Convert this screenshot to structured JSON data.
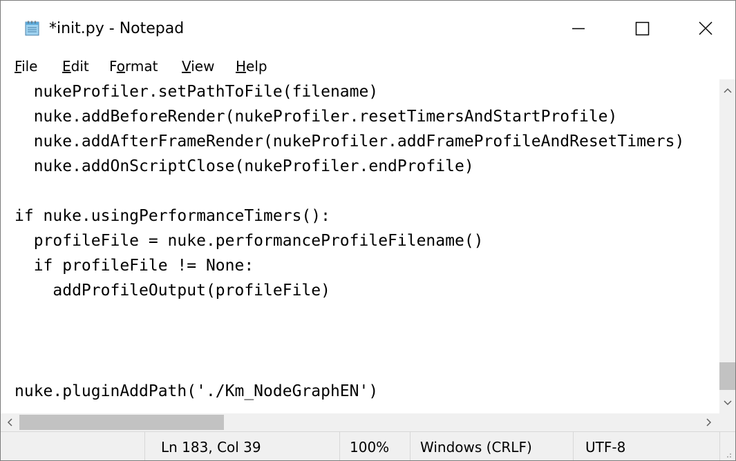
{
  "window": {
    "title": "*init.py - Notepad",
    "icon": "notepad-icon",
    "controls": [
      "minimize-icon",
      "maximize-icon",
      "close-icon"
    ]
  },
  "menu": {
    "items": [
      {
        "first": "F",
        "rest": "ile"
      },
      {
        "first": "E",
        "rest": "dit"
      },
      {
        "pre": "F",
        "first": "o",
        "rest": "rmat"
      },
      {
        "first": "V",
        "rest": "iew"
      },
      {
        "first": "H",
        "rest": "elp"
      }
    ]
  },
  "editor": {
    "lines": [
      "  nukeProfiler.setPathToFile(filename)",
      "  nuke.addBeforeRender(nukeProfiler.resetTimersAndStartProfile)",
      "  nuke.addAfterFrameRender(nukeProfiler.addFrameProfileAndResetTimers)",
      "  nuke.addOnScriptClose(nukeProfiler.endProfile)",
      "",
      "if nuke.usingPerformanceTimers():",
      "  profileFile = nuke.performanceProfileFilename()",
      "  if profileFile != None:",
      "    addProfileOutput(profileFile)",
      "",
      "",
      "",
      "",
      "nuke.pluginAddPath('./Km_NodeGraphEN')"
    ]
  },
  "statusbar": {
    "position": "Ln 183, Col 39",
    "zoom": "100%",
    "line_ending": "Windows (CRLF)",
    "encoding": "UTF-8"
  },
  "colors": {
    "scrollbar_track": "#f0f0f0",
    "scrollbar_thumb": "#c2c2c2",
    "statusbar_bg": "#f0f0f0"
  }
}
